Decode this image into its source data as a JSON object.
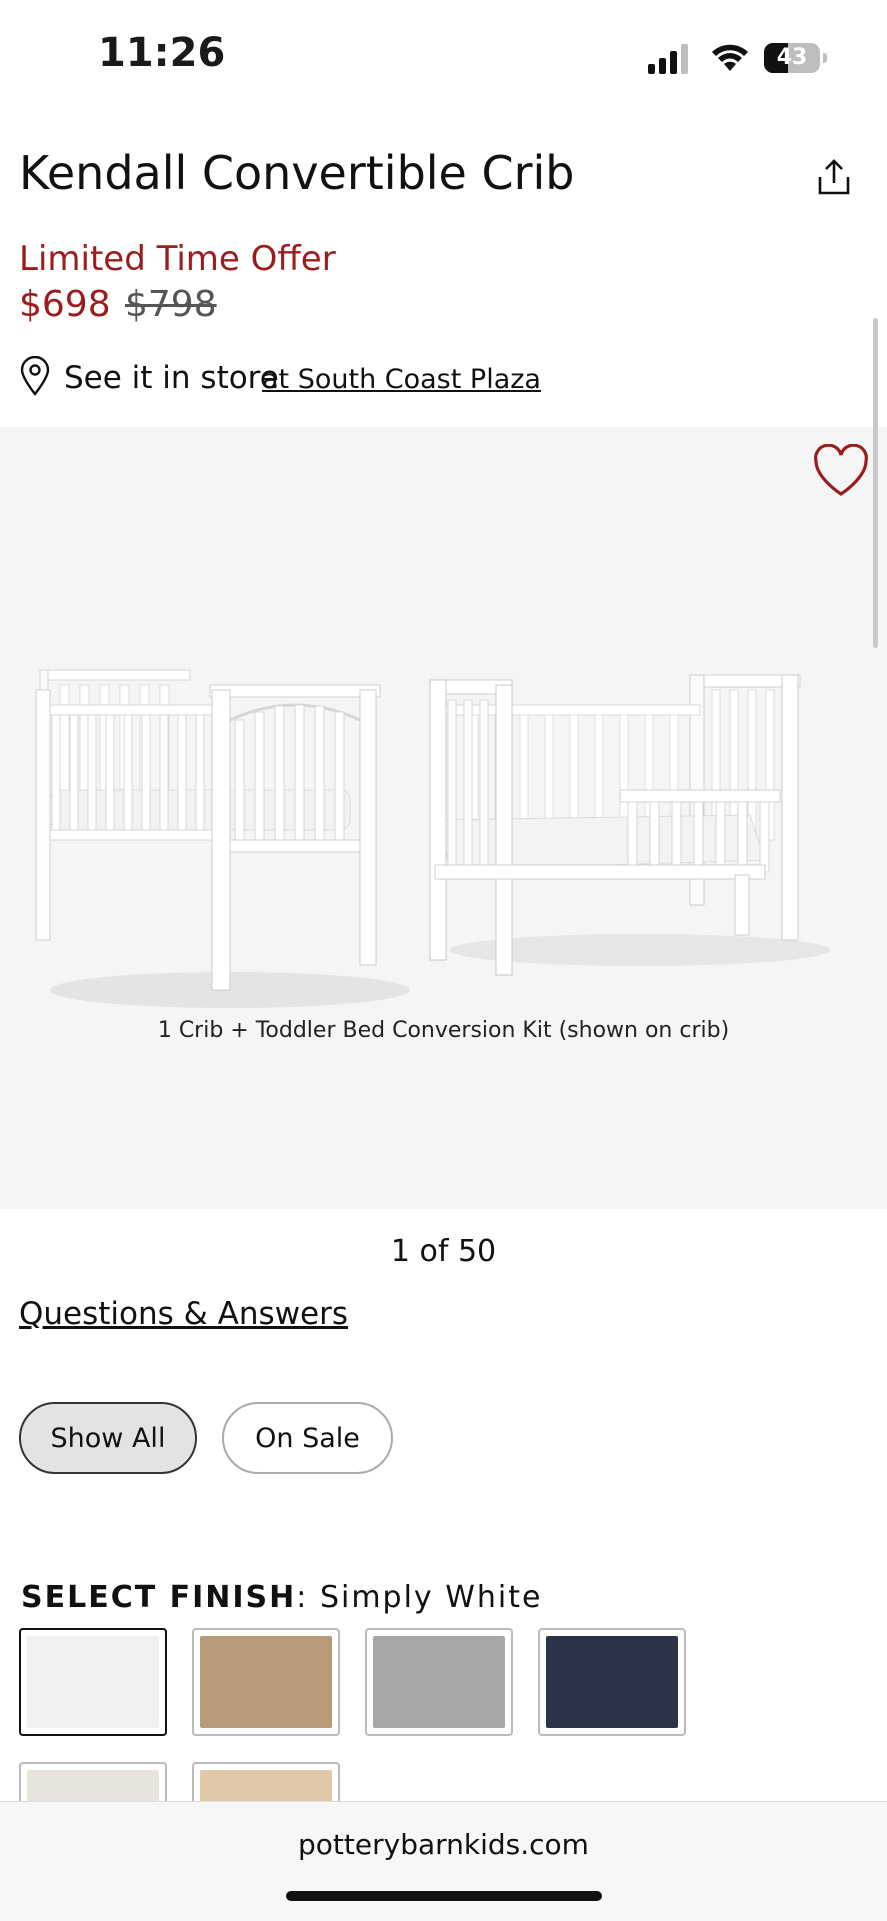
{
  "status": {
    "time": "11:26",
    "battery": "43",
    "battery_level": 0.43
  },
  "product": {
    "title": "Kendall Convertible Crib",
    "offer_label": "Limited Time Offer",
    "price": "$698",
    "original_price": "$798",
    "store_prefix": "See it in store",
    "store_link": "at South Coast Plaza"
  },
  "gallery": {
    "caption": "1 Crib + Toddler Bed Conversion Kit (shown on crib)",
    "pager": "1 of 50"
  },
  "qa_link": "Questions & Answers",
  "filters": {
    "show_all": "Show All",
    "on_sale": "On Sale"
  },
  "finish": {
    "label": "SELECT FINISH",
    "separator": ":",
    "selected": "Simply White",
    "swatches": [
      {
        "color": "#f1f1f1",
        "selected": true
      },
      {
        "color": "#b89a78"
      },
      {
        "color": "#a9a7a5"
      },
      {
        "color": "#2b3348"
      },
      {
        "color": "#e8e4dc"
      },
      {
        "color": "#e0c8a8"
      }
    ]
  },
  "browser": {
    "url": "potterybarnkids.com"
  },
  "colors": {
    "accent": "#9b1c1c"
  },
  "icons": [
    "signal-icon",
    "wifi-icon",
    "battery-icon",
    "share-icon",
    "location-pin-icon",
    "heart-icon"
  ]
}
